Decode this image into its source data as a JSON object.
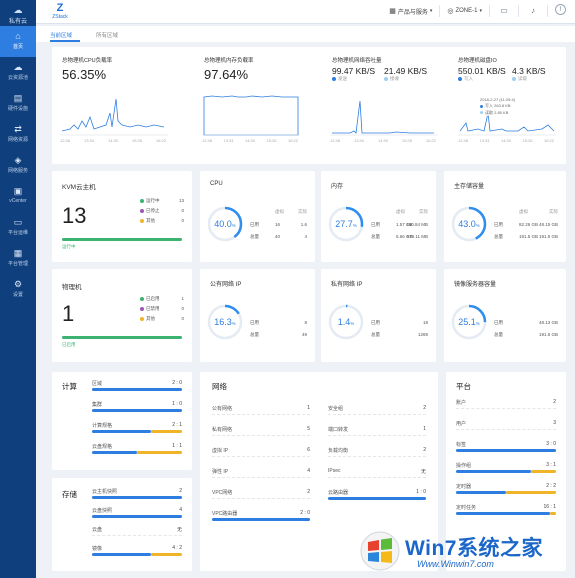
{
  "sidebar": {
    "brand": "私有云",
    "items": [
      {
        "label": "首页",
        "icon": "home-icon",
        "glyph": "⌂"
      },
      {
        "label": "云资源池",
        "icon": "cloud-icon",
        "glyph": "☁"
      },
      {
        "label": "硬件设施",
        "icon": "server-icon",
        "glyph": "▤"
      },
      {
        "label": "网络资源",
        "icon": "network-icon",
        "glyph": "⇄"
      },
      {
        "label": "网络服务",
        "icon": "service-icon",
        "glyph": "◈"
      },
      {
        "label": "vCenter",
        "icon": "vcenter-icon",
        "glyph": "▣"
      },
      {
        "label": "平台运维",
        "icon": "monitor-icon",
        "glyph": "▭"
      },
      {
        "label": "平台管理",
        "icon": "manage-icon",
        "glyph": "▦"
      },
      {
        "label": "设置",
        "icon": "gear-icon",
        "glyph": "⚙"
      }
    ]
  },
  "header": {
    "logo": "ZStack",
    "product_menu": "产品与服务",
    "zone": "ZONE-1"
  },
  "tabs": [
    "当前区域",
    "所有区域"
  ],
  "metrics": [
    {
      "title": "总物理机CPU负载率",
      "value": "56.35%"
    },
    {
      "title": "总物理机内存负载率",
      "value": "97.64%"
    },
    {
      "title": "总物理机网络吞吐量",
      "v1": "99.47 KB/S",
      "v2": "21.49 KB/S",
      "l1": "发送",
      "l2": "接收"
    },
    {
      "title": "总物理机磁盘IO",
      "v1": "550.01 KB/S",
      "v2": "4.3 KB/S",
      "l1": "写入",
      "l2": "读取",
      "tip_date": "2018-2-27 (11:25:4)",
      "tip_write": "写入",
      "tip_write_val": "263.8 KB",
      "tip_read": "读取",
      "tip_read_val": "2.85 KB"
    }
  ],
  "time_ticks": [
    "12:38",
    "13:34",
    "14:30",
    "15:26",
    "16:22"
  ],
  "kvm": {
    "title": "KVM云主机",
    "count": "13",
    "legend": [
      {
        "label": "运行中",
        "val": "13",
        "color": "#3cb371"
      },
      {
        "label": "已停止",
        "val": "0",
        "color": "#9b59b6"
      },
      {
        "label": "其他",
        "val": "0",
        "color": "#f0b429"
      }
    ],
    "foot": "运行中"
  },
  "host": {
    "title": "物理机",
    "count": "1",
    "legend": [
      {
        "label": "已启用",
        "val": "1",
        "color": "#3cb371"
      },
      {
        "label": "已禁用",
        "val": "0",
        "color": "#9b59b6"
      },
      {
        "label": "其他",
        "val": "0",
        "color": "#f0b429"
      }
    ],
    "foot": "已启用"
  },
  "rings": [
    {
      "title": "CPU",
      "pct": "40.0",
      "pct_num": 40,
      "col_a": "虚拟",
      "col_b": "实际",
      "r1": "已用",
      "r1a": "16",
      "r1b": "1.6",
      "r2": "总量",
      "r2a": "40",
      "r2b": "4"
    },
    {
      "title": "内存",
      "pct": "27.7",
      "pct_num": 27.7,
      "col_a": "虚拟",
      "col_b": "实际",
      "r1": "已用",
      "r1a": "1.57 GB",
      "r1b": "160.84 MB",
      "r2": "总量",
      "r2a": "5.66 GB",
      "r2b": "579.11 MB"
    },
    {
      "title": "主存储容量",
      "pct": "43.0",
      "pct_num": 43,
      "col_a": "虚拟",
      "col_b": "实际",
      "r1": "已用",
      "r1a": "82.26 GB",
      "r1b": "48.15 GB",
      "r2": "总量",
      "r2a": "191.5 GB",
      "r2b": "191.5 GB"
    },
    {
      "title": "公有网络 IP",
      "pct": "16.3",
      "pct_num": 16.3,
      "r1": "已用",
      "r1b": "8",
      "r2": "总量",
      "r2b": "49"
    },
    {
      "title": "私有网络 IP",
      "pct": "1.4",
      "pct_num": 1.4,
      "r1": "已用",
      "r1b": "18",
      "r2": "总量",
      "r2b": "1269"
    },
    {
      "title": "镜像服务器容量",
      "pct": "25.1",
      "pct_num": 25.1,
      "r1": "已用",
      "r1b": "48.13 GB",
      "r2": "总量",
      "r2b": "191.5 GB"
    }
  ],
  "compute": {
    "title": "计算",
    "rows": [
      {
        "label": "区域",
        "val": "2 : 0",
        "fill": 1
      },
      {
        "label": "集群",
        "val": "1 : 0",
        "fill": 1
      },
      {
        "label": "计算规格",
        "val": "2 : 1",
        "fill": 0.66
      },
      {
        "label": "云盘规格",
        "val": "1 : 1",
        "fill": 0.5
      }
    ]
  },
  "storage": {
    "title": "存储",
    "rows": [
      {
        "label": "云主机快照",
        "val": "2",
        "fill": 1
      },
      {
        "label": "云盘快照",
        "val": "4",
        "fill": 1
      },
      {
        "label": "云盘",
        "val": "无",
        "fill": 0
      },
      {
        "label": "镜像",
        "val": "4 : 2",
        "fill": 0.66
      }
    ]
  },
  "network": {
    "title": "网络",
    "left": [
      {
        "label": "公有网络",
        "val": "1"
      },
      {
        "label": "私有网络",
        "val": "5"
      },
      {
        "label": "虚拟 IP",
        "val": "6"
      },
      {
        "label": "弹性 IP",
        "val": "4"
      },
      {
        "label": "VPC网络",
        "val": "2"
      },
      {
        "label": "VPC路由器",
        "val": "2 : 0"
      }
    ],
    "right": [
      {
        "label": "安全组",
        "val": "2"
      },
      {
        "label": "端口转发",
        "val": "1"
      },
      {
        "label": "负载均衡",
        "val": "2"
      },
      {
        "label": "IPsec",
        "val": "无"
      },
      {
        "label": "云路由器",
        "val": "1 : 0"
      }
    ]
  },
  "platform": {
    "title": "平台",
    "rows": [
      {
        "label": "账户",
        "val": "2",
        "fill": 0
      },
      {
        "label": "用户",
        "val": "3",
        "fill": 0
      },
      {
        "label": "标签",
        "val": "3 : 0",
        "fill": 1
      },
      {
        "label": "操作组",
        "val": "3 : 1",
        "fill": 0.75
      },
      {
        "label": "定时器",
        "val": "2 : 2",
        "fill": 0.5
      },
      {
        "label": "定时任务",
        "val": "16 : 1",
        "fill": 0.94
      }
    ]
  },
  "watermark": {
    "brand": "Win7系统之家",
    "url": "Www.Winwin7.com"
  }
}
